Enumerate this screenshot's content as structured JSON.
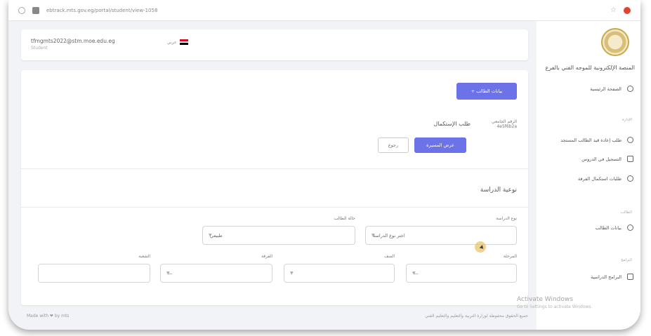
{
  "browser": {
    "url": "ebtrack.mts.gov.eg/portal/student/view-1058"
  },
  "header": {
    "email": "tfmgmts2022@stm.moe.edu.eg",
    "role": "Student",
    "language": "عربي"
  },
  "main": {
    "primary_action": "+ بيانات الطالب",
    "status_title": "طلب الإستكمال",
    "student_label": "الرقم الجامعي",
    "student_id": "4e5f6b2a",
    "view_button": "عرض المسيرة",
    "back_button": "رجوع",
    "section_title": "نوعية الدراسة",
    "fields": {
      "study_type": {
        "label": "نوع الدراسة",
        "value": "اختر نوع الدراسة"
      },
      "student_status": {
        "label": "حالة الطالب",
        "value": "طبيعي"
      },
      "stage": {
        "label": "المرحلة",
        "value": "—"
      },
      "grade": {
        "label": "الصف",
        "value": ""
      },
      "class": {
        "label": "الفرقة",
        "value": "—"
      },
      "section": {
        "label": "الشعبة",
        "value": ""
      }
    }
  },
  "sidebar": {
    "brand": "المنصة الإلكترونية للموجه الفني بالفرع",
    "home": "الصفحة الرئيسية",
    "section1": "الإدارة",
    "item1": "طلب إعادة قيد الطالب المستجد",
    "item2": "التسجيل في الدروس",
    "item3": "طلبات استكمال الفرقة",
    "section2": "الطالب",
    "item4": "بيانات الطالب",
    "section3": "البرامج",
    "item5": "البرامج الدراسية"
  },
  "footer": {
    "left": "Made with ❤ by mts",
    "right": "جميع الحقوق محفوظة لوزارة التربية والتعليم والتعليم الفني"
  },
  "watermark": {
    "title": "Activate Windows",
    "subtitle": "Go to Settings to activate Windows."
  },
  "colors": {
    "primary": "#6c72e8",
    "sidebar_bg": "#ffffff",
    "page_bg": "#f2f3f7"
  }
}
